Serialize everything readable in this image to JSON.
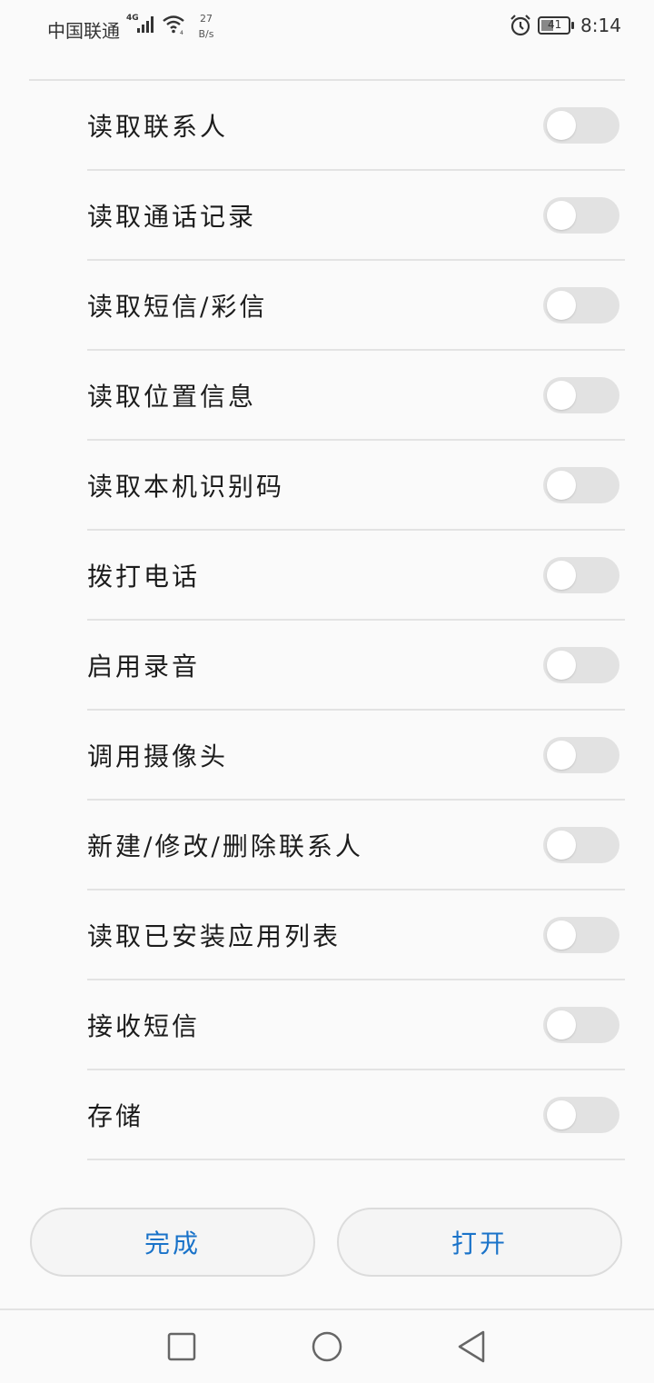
{
  "status_bar": {
    "carrier": "中国联通",
    "network_type": "4G",
    "net_speed_value": "27",
    "net_speed_unit": "B/s",
    "battery_level": "41",
    "time": "8:14",
    "icons": [
      "signal-icon",
      "wifi-icon",
      "alarm-icon",
      "battery-icon"
    ]
  },
  "permissions": [
    {
      "label": "读取联系人",
      "enabled": false
    },
    {
      "label": "读取通话记录",
      "enabled": false
    },
    {
      "label": "读取短信/彩信",
      "enabled": false
    },
    {
      "label": "读取位置信息",
      "enabled": false
    },
    {
      "label": "读取本机识别码",
      "enabled": false
    },
    {
      "label": "拨打电话",
      "enabled": false
    },
    {
      "label": "启用录音",
      "enabled": false
    },
    {
      "label": "调用摄像头",
      "enabled": false
    },
    {
      "label": "新建/修改/删除联系人",
      "enabled": false
    },
    {
      "label": "读取已安装应用列表",
      "enabled": false
    },
    {
      "label": "接收短信",
      "enabled": false
    },
    {
      "label": "存储",
      "enabled": false
    }
  ],
  "actions": {
    "done_label": "完成",
    "open_label": "打开"
  },
  "colors": {
    "accent": "#1a73c9",
    "toggle_off": "#e2e2e2",
    "background": "#fafafa"
  },
  "nav_bar": {
    "icons": [
      "recent-apps-icon",
      "home-icon",
      "back-icon"
    ]
  }
}
